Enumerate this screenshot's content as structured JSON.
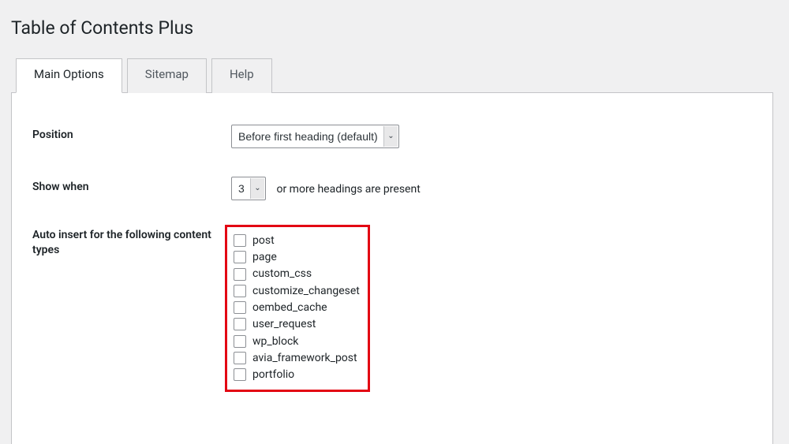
{
  "page_title": "Table of Contents Plus",
  "tabs": {
    "main": "Main Options",
    "sitemap": "Sitemap",
    "help": "Help"
  },
  "fields": {
    "position": {
      "label": "Position",
      "value": "Before first heading (default)"
    },
    "show_when": {
      "label": "Show when",
      "value": "3",
      "suffix": "or more headings are present"
    },
    "auto_insert": {
      "label": "Auto insert for the following content types",
      "options": [
        "post",
        "page",
        "custom_css",
        "customize_changeset",
        "oembed_cache",
        "user_request",
        "wp_block",
        "avia_framework_post",
        "portfolio"
      ]
    }
  }
}
